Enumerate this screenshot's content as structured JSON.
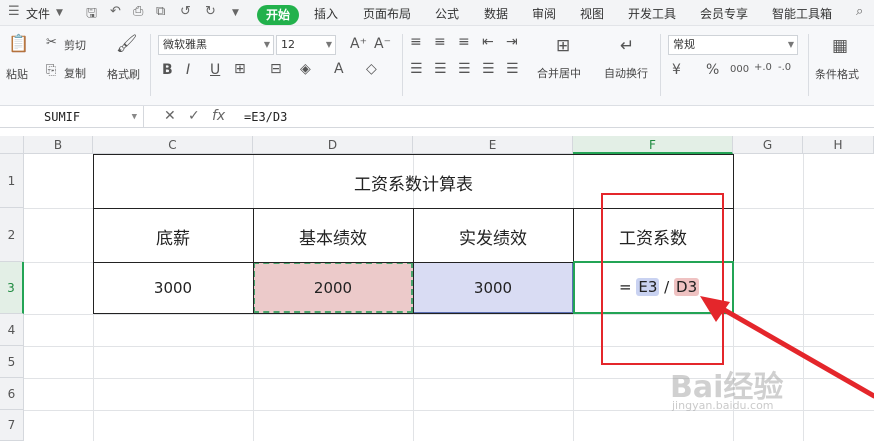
{
  "menubar": {
    "file_label": "文件",
    "tabs": [
      "开始",
      "插入",
      "页面布局",
      "公式",
      "数据",
      "审阅",
      "视图",
      "开发工具",
      "会员专享",
      "智能工具箱"
    ],
    "active_tab": "开始"
  },
  "ribbon": {
    "paste": "粘贴",
    "cut": "剪切",
    "copy": "复制",
    "format_painter": "格式刷",
    "font_name": "微软雅黑",
    "font_size": "12",
    "merge_center": "合并居中",
    "wrap_text": "自动换行",
    "number_format": "常规",
    "conditional_format": "条件格式"
  },
  "formula_bar": {
    "name_box": "SUMIF",
    "formula": "=E3/D3"
  },
  "grid": {
    "columns": [
      "B",
      "C",
      "D",
      "E",
      "F",
      "G",
      "H"
    ],
    "rows": [
      "1",
      "2",
      "3",
      "4",
      "5",
      "6",
      "7"
    ],
    "selected_column": "F",
    "selected_row": "3"
  },
  "table": {
    "title": "工资系数计算表",
    "headers": [
      "底薪",
      "基本绩效",
      "实发绩效",
      "工资系数"
    ],
    "values": [
      "3000",
      "2000",
      "3000"
    ],
    "formula_eq": "=",
    "formula_ref1": "E3",
    "formula_div": "/",
    "formula_ref2": "D3"
  },
  "watermark": {
    "brand": "Bai经验",
    "url": "jingyan.baidu.com"
  },
  "colors": {
    "accent_green": "#22b14c",
    "annotation_red": "#e4262b"
  }
}
